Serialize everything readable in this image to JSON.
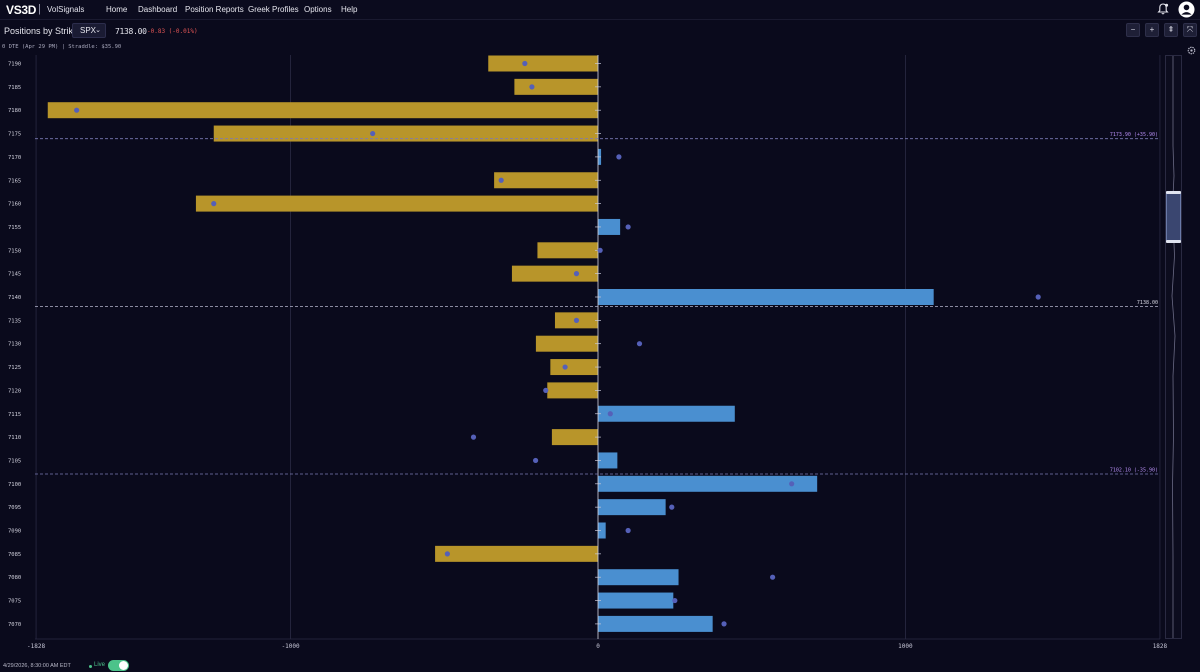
{
  "app": {
    "logo": "VS3D",
    "logo_separator": "|",
    "brand": "VolSignals"
  },
  "nav": [
    {
      "label": "Home"
    },
    {
      "label": "Dashboard"
    },
    {
      "label": "Position Reports"
    },
    {
      "label": "Greek Profiles"
    },
    {
      "label": "Options"
    },
    {
      "label": "Help"
    }
  ],
  "header_icons": {
    "bell": "bell-icon",
    "avatar": "user-avatar-icon"
  },
  "toolbar": {
    "title": "Positions by Strike",
    "symbol": "SPX",
    "symbol_caret": "⌄",
    "price": "7138.00",
    "change": "-0.83 (-0.01%)",
    "buttons": [
      "−",
      "+",
      "⇞",
      "⤧"
    ]
  },
  "subheader": "0 DTE (Apr 29 PM)  |  Straddle: $35.90",
  "colors": {
    "negative_bar": "#b8952a",
    "positive_bar": "#4a8fd0",
    "marker": "#5560b8",
    "reference_line": "#7a7ab4",
    "reference_label": "#b48cf0",
    "price_line": "#b4b4cc",
    "grid": "#2a2a44"
  },
  "chart_data": {
    "type": "bar",
    "orientation": "horizontal",
    "x_range": [
      -1828,
      1828
    ],
    "x_ticks": [
      {
        "value": -1828,
        "label": "-1828"
      },
      {
        "value": -1000,
        "label": "-1000"
      },
      {
        "value": 0,
        "label": "0"
      },
      {
        "value": 1000,
        "label": "1000"
      },
      {
        "value": 1828,
        "label": "1828"
      }
    ],
    "grid": true,
    "strikes": [
      "7190",
      "7185",
      "7180",
      "7175",
      "7170",
      "7165",
      "7160",
      "7155",
      "7150",
      "7145",
      "7140",
      "7135",
      "7130",
      "7125",
      "7120",
      "7115",
      "7110",
      "7105",
      "7100",
      "7095",
      "7090",
      "7085",
      "7080",
      "7075",
      "7070"
    ],
    "values": [
      -357,
      -272,
      -1790,
      -1250,
      10,
      -338,
      -1308,
      72,
      -197,
      -280,
      1092,
      -140,
      -202,
      -155,
      -165,
      445,
      -150,
      63,
      713,
      220,
      25,
      -530,
      262,
      245,
      373
    ],
    "markers": [
      -238,
      -215,
      -1696,
      -733,
      68,
      -315,
      -1250,
      98,
      7,
      -70,
      1432,
      -70,
      135,
      -107,
      -170,
      40,
      -405,
      -203,
      630,
      240,
      98,
      -490,
      568,
      250,
      410
    ],
    "reference_lines": [
      {
        "y": 7173.9,
        "label": "7173.90 (+35.90)"
      },
      {
        "y": 7138.0,
        "label": "7138.00"
      },
      {
        "y": 7102.1,
        "label": "7102.10 (-35.90)"
      }
    ]
  },
  "footer": {
    "timestamp": "4/29/2026, 8:30:00 AM EDT",
    "live_label": "Live"
  }
}
